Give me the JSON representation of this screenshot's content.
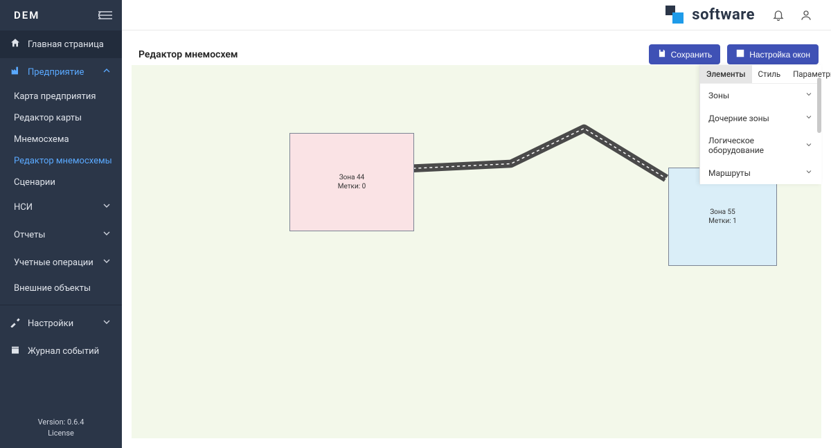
{
  "app": {
    "logo": "DEM"
  },
  "brand": {
    "text": "software"
  },
  "sidebar": {
    "home": "Главная страница",
    "enterprise": {
      "label": "Предприятие",
      "items": [
        "Карта предприятия",
        "Редактор карты",
        "Мнемосхема",
        "Редактор мнемосхемы",
        "Сценарии"
      ]
    },
    "nsi": "НСИ",
    "reports": "Отчеты",
    "accounting": "Учетные операции",
    "external": "Внешние объекты",
    "settings": "Настройки",
    "eventlog": "Журнал событий"
  },
  "footer": {
    "version": "Version: 0.6.4",
    "license": "License"
  },
  "page": {
    "title": "Редактор мнемосхем",
    "save": "Сохранить",
    "windows": "Настройка окон"
  },
  "props": {
    "tabs": [
      "Элементы",
      "Стиль",
      "Параметры"
    ],
    "sections": [
      "Зоны",
      "Дочерние зоны",
      "Логическое оборудование",
      "Маршруты"
    ]
  },
  "zones": {
    "z44": {
      "name": "Зона 44",
      "tags": "Метки: 0"
    },
    "z55": {
      "name": "Зона 55",
      "tags": "Метки: 1"
    }
  }
}
